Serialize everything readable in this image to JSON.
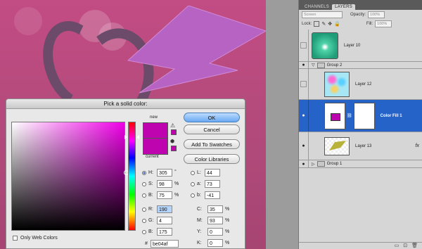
{
  "layers_panel": {
    "tabs": [
      "CHANNELS",
      "LAYERS"
    ],
    "blend_mode": "Screen",
    "opacity_label": "Opacity:",
    "opacity_value": "100%",
    "lock_label": "Lock:",
    "fill_label": "Fill:",
    "fill_value": "100%",
    "layers": [
      {
        "name": "Layer 10"
      },
      {
        "name": "Group 2"
      },
      {
        "name": "Layer 12"
      },
      {
        "name": "Color Fill 1"
      },
      {
        "name": "Layer 13",
        "fx": "fx"
      },
      {
        "name": "Group 1"
      }
    ]
  },
  "dialog": {
    "title": "Pick a solid color:",
    "new_label": "new",
    "current_label": "current",
    "buttons": {
      "ok": "OK",
      "cancel": "Cancel",
      "add_to_swatches": "Add To Swatches",
      "color_libraries": "Color Libraries"
    },
    "hsb": [
      {
        "label": "H:",
        "value": "305",
        "unit": "°"
      },
      {
        "label": "S:",
        "value": "98",
        "unit": "%"
      },
      {
        "label": "B:",
        "value": "75",
        "unit": "%"
      }
    ],
    "rgb": [
      {
        "label": "R:",
        "value": "190"
      },
      {
        "label": "G:",
        "value": "4"
      },
      {
        "label": "B:",
        "value": "175"
      }
    ],
    "lab": [
      {
        "label": "L:",
        "value": "44"
      },
      {
        "label": "a:",
        "value": "73"
      },
      {
        "label": "b:",
        "value": "-41"
      }
    ],
    "cmyk": [
      {
        "label": "C:",
        "value": "35",
        "unit": "%"
      },
      {
        "label": "M:",
        "value": "93",
        "unit": "%"
      },
      {
        "label": "Y:",
        "value": "0",
        "unit": "%"
      },
      {
        "label": "K:",
        "value": "0",
        "unit": "%"
      }
    ],
    "hex_label": "#",
    "hex_value": "be04af",
    "only_web_colors": "Only Web Colors",
    "selected_color": "#be04af"
  }
}
